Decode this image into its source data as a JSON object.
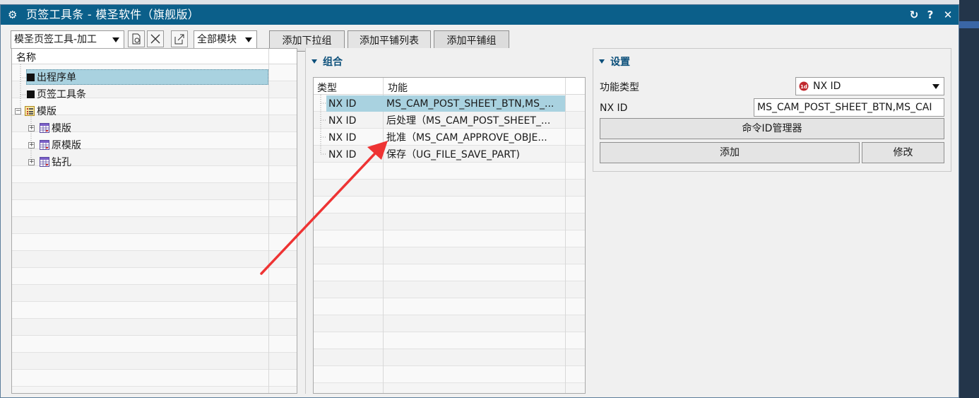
{
  "window": {
    "title": "页签工具条 - 模圣软件（旗舰版）"
  },
  "toolbar": {
    "toolbar_combo": "模圣页签工具-加工",
    "module_combo": "全部模块",
    "add_dropdown": "添加下拉组",
    "add_tile_list": "添加平铺列表",
    "add_tile_group": "添加平铺组"
  },
  "tree": {
    "header": "名称",
    "items": [
      {
        "label": "出程序单",
        "level": 1,
        "selected": true
      },
      {
        "label": "页签工具条",
        "level": 1
      },
      {
        "label": "模版",
        "level": 0,
        "expanded": true
      },
      {
        "label": "模版",
        "level": 1,
        "collapsed": true
      },
      {
        "label": "原模版",
        "level": 1,
        "collapsed": true
      },
      {
        "label": "钻孔",
        "level": 1,
        "collapsed": true
      }
    ]
  },
  "group": {
    "title": "组合",
    "columns": [
      "类型",
      "功能"
    ],
    "rows": [
      {
        "type": "NX ID",
        "func": "MS_CAM_POST_SHEET_BTN,MS_...",
        "selected": true
      },
      {
        "type": "NX ID",
        "func": "后处理（MS_CAM_POST_SHEET_..."
      },
      {
        "type": "NX ID",
        "func": "批准（MS_CAM_APPROVE_OBJE..."
      },
      {
        "type": "NX ID",
        "func": "保存（UG_FILE_SAVE_PART)"
      }
    ]
  },
  "settings": {
    "title": "设置",
    "func_type_label": "功能类型",
    "func_type_value": "NX ID",
    "nxid_label": "NX ID",
    "nxid_value": "MS_CAM_POST_SHEET_BTN,MS_CAI",
    "cmd_manager": "命令ID管理器",
    "add": "添加",
    "modify": "修改"
  },
  "colors": {
    "titlebar": "#0b5f8a",
    "selection": "#a9d2e0",
    "annotation_arrow": "#ee3333"
  }
}
